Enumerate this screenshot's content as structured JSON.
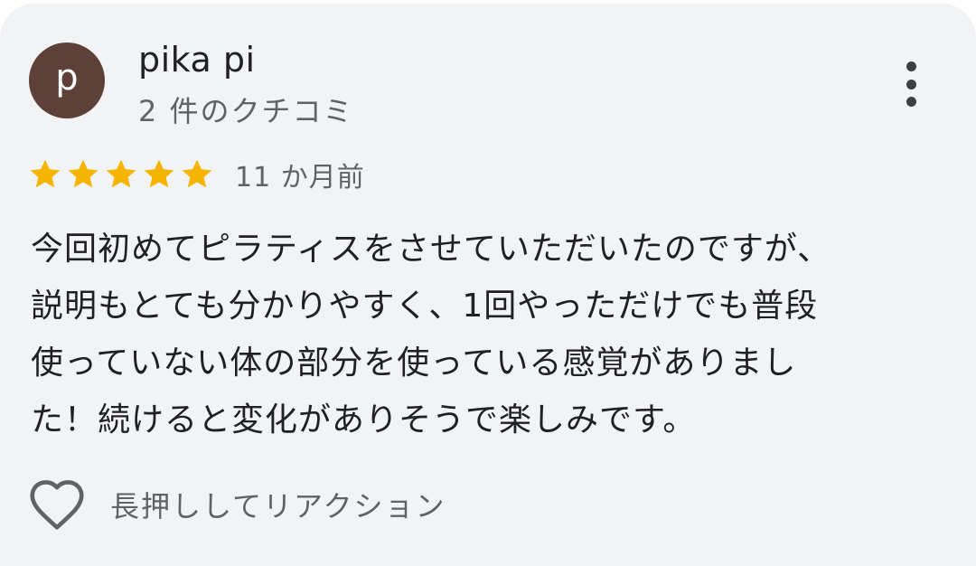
{
  "review": {
    "author": {
      "avatar_letter": "p",
      "avatar_color": "#5d4037",
      "name": "pika pi",
      "review_count": "2 件のクチコミ"
    },
    "more_menu_icon": "more-vert-icon",
    "rating": {
      "stars": 5,
      "max_stars": 5,
      "star_color": "#f4b400",
      "icon": "star-icon"
    },
    "time_ago": "11 か月前",
    "text": "今回初めてピラティスをさせていただいたのですが、\n説明もとても分かりやすく、1回やっただけでも普段\n使っていない体の部分を使っている感覚がありまし\nた！続けると変化がありそうで楽しみです。",
    "reaction": {
      "icon": "heart-outline-icon",
      "label": "長押ししてリアクション"
    }
  }
}
